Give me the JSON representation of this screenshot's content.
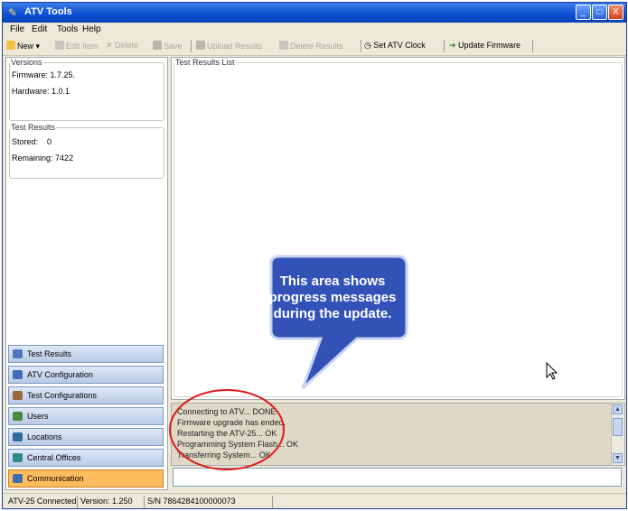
{
  "window": {
    "title": "ATV Tools"
  },
  "titlebar_buttons": {
    "minimize": "_",
    "maximize": "□",
    "close": "X"
  },
  "menu": [
    "File",
    "Edit",
    "Tools",
    "Help"
  ],
  "toolbar": {
    "new": "New",
    "edit_item": "Edit Item",
    "delete": "Delete",
    "save": "Save",
    "upload_results": "Upload Results",
    "delete_results": "Delete Results",
    "set_clock": "Set ATV Clock",
    "update_firmware": "Update Firmware"
  },
  "versions": {
    "legend": "Versions",
    "firmware_label": "Firmware:",
    "firmware_value": "1.7.25.",
    "hardware_label": "Hardware:",
    "hardware_value": "1.0.1"
  },
  "test_results_group": {
    "legend": "Test Results",
    "stored_label": "Stored:",
    "stored_value": "0",
    "remaining_label": "Remaining:",
    "remaining_value": "7422"
  },
  "nav": [
    {
      "label": "Test Results",
      "icon": "list-icon",
      "color": "#4f78b8"
    },
    {
      "label": "ATV Configuration",
      "icon": "config-icon",
      "color": "#3f6fb0"
    },
    {
      "label": "Test Configurations",
      "icon": "test-config-icon",
      "color": "#9a6a3a"
    },
    {
      "label": "Users",
      "icon": "users-icon",
      "color": "#4a8a3a"
    },
    {
      "label": "Locations",
      "icon": "location-icon",
      "color": "#2f6a9a"
    },
    {
      "label": "Central Offices",
      "icon": "office-icon",
      "color": "#2e8a88"
    },
    {
      "label": "Communication",
      "icon": "communication-icon",
      "color": "#3f6fb0"
    }
  ],
  "active_nav": "Communication",
  "test_results_list": {
    "legend": "Test Results List"
  },
  "messages": [
    "Connecting to ATV... DONE",
    "Firmware upgrade has ended.",
    "Restarting the ATV-25... OK",
    "Programming System Flash... OK",
    "Transferring System... OK"
  ],
  "callout": {
    "lines": [
      "This area shows",
      "progress messages",
      "during the update."
    ],
    "fill": "#3352b8"
  },
  "status": {
    "connected": "ATV-25 Connected",
    "version": "Version: 1.250",
    "serial": "S/N 7864284100000073"
  },
  "colors": {
    "titlebar": "#0a4fd0",
    "active_nav": "#ffbc5c",
    "highlight_circle": "#e01818"
  }
}
